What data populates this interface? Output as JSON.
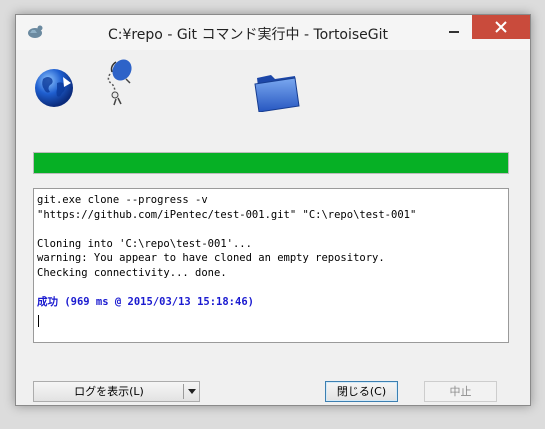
{
  "window": {
    "title": "C:¥repo - Git コマンド実行中 - TortoiseGit"
  },
  "progress": {
    "value": 1.0,
    "color": "#06b025"
  },
  "log": {
    "lines": [
      "git.exe clone --progress -v",
      "\"https://github.com/iPentec/test-001.git\" \"C:\\repo\\test-001\"",
      "",
      "Cloning into 'C:\\repo\\test-001'...",
      "warning: You appear to have cloned an empty repository.",
      "Checking connectivity... done.",
      ""
    ],
    "success": "成功 (969 ms @ 2015/03/13 15:18:46)"
  },
  "buttons": {
    "show_log": "ログを表示(L)",
    "close": "閉じる(C)",
    "abort": "中止"
  },
  "colors": {
    "close_button_bg": "#c94b3c",
    "success_text": "#1a1ad0"
  }
}
